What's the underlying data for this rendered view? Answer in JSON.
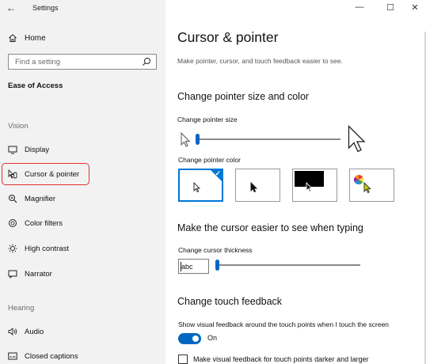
{
  "window": {
    "title": "Settings",
    "back_glyph": "←",
    "minimize_glyph": "—",
    "maximize_glyph": "☐",
    "close_glyph": "✕"
  },
  "sidebar": {
    "home_label": "Home",
    "search_placeholder": "Find a setting",
    "section_title": "Ease of Access",
    "groups": [
      {
        "label": "Vision"
      },
      {
        "label": "Hearing"
      }
    ],
    "items": [
      {
        "label": "Display",
        "icon": "display-icon"
      },
      {
        "label": "Cursor & pointer",
        "icon": "cursor-pointer-icon",
        "selected": true
      },
      {
        "label": "Magnifier",
        "icon": "magnifier-icon"
      },
      {
        "label": "Color filters",
        "icon": "color-filters-icon"
      },
      {
        "label": "High contrast",
        "icon": "high-contrast-icon"
      },
      {
        "label": "Narrator",
        "icon": "narrator-icon"
      },
      {
        "label": "Audio",
        "icon": "audio-icon"
      },
      {
        "label": "Closed captions",
        "icon": "closed-captions-icon"
      }
    ]
  },
  "main": {
    "title": "Cursor & pointer",
    "subtitle": "Make pointer, cursor, and touch feedback easier to see.",
    "pointer_section": {
      "heading": "Change pointer size and color",
      "size_label": "Change pointer size",
      "size_value": 1,
      "color_label": "Change pointer color",
      "color_options": [
        "white",
        "black",
        "inverted",
        "custom"
      ],
      "selected_color_index": 0
    },
    "cursor_section": {
      "heading": "Make the cursor easier to see when typing",
      "thickness_label": "Change cursor thickness",
      "preview_text": "abc",
      "thickness_value": 1
    },
    "touch_section": {
      "heading": "Change touch feedback",
      "feedback_label": "Show visual feedback around the touch points when I touch the screen",
      "toggle_state": "On",
      "toggle_on": true,
      "darker_label": "Make visual feedback for touch points darker and larger",
      "darker_checked": false
    }
  },
  "colors": {
    "accent": "#0067c0",
    "highlight": "#e03030",
    "sidebar_bg": "#f2f2f2"
  }
}
